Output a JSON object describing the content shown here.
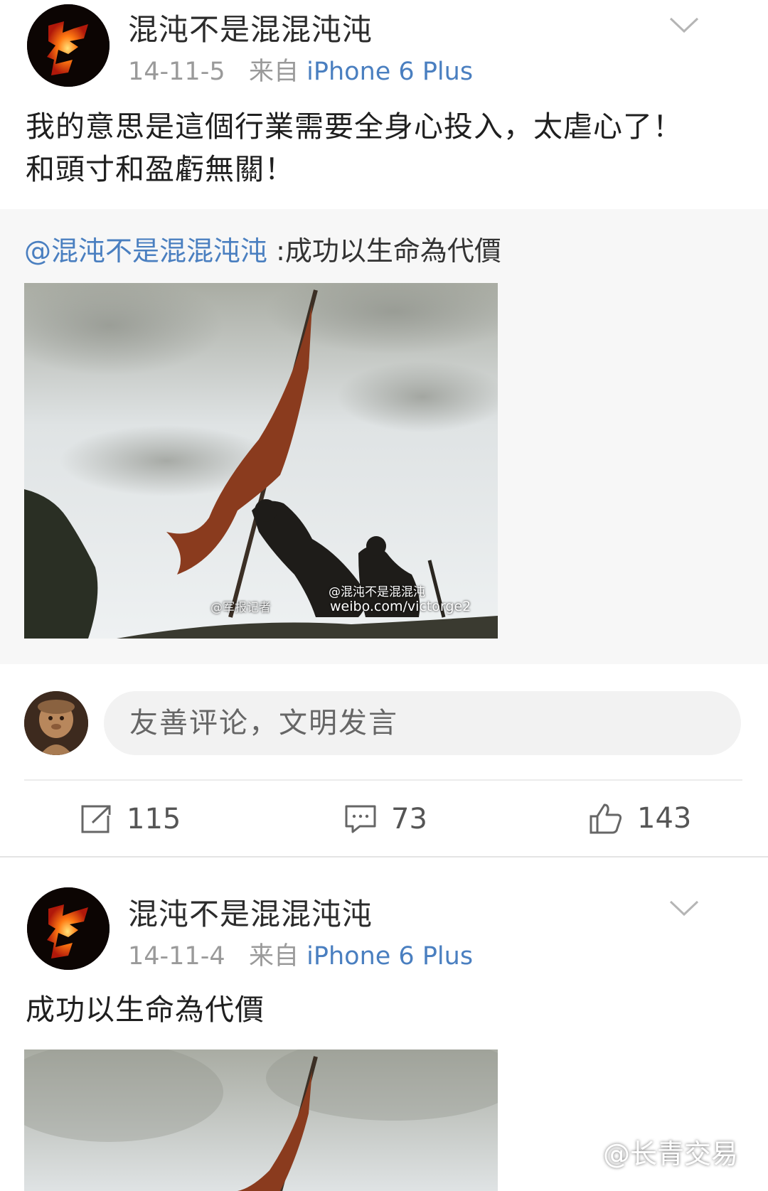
{
  "post1": {
    "username": "混沌不是混混沌沌",
    "date": "14-11-5",
    "from_label": "来自",
    "source": "iPhone 6 Plus",
    "text_line1": "我的意思是這個行業需要全身心投入，太虐心了！",
    "text_line2": "和頭寸和盈虧無關！",
    "retweet": {
      "user": "@混沌不是混混沌沌",
      "text": ":成功以生命為代價",
      "photo_watermark_user": "@混沌不是混混沌",
      "photo_watermark_url": "weibo.com/victorge2",
      "photo_credit": "@军报记者"
    }
  },
  "comment_bar": {
    "placeholder": "友善评论，文明发言"
  },
  "actions": {
    "repost_count": "115",
    "comment_count": "73",
    "like_count": "143"
  },
  "post2": {
    "username": "混沌不是混混沌沌",
    "date": "14-11-4",
    "from_label": "来自",
    "source": "iPhone 6 Plus",
    "text": "成功以生命為代價"
  },
  "watermark": "@长青交易",
  "icons": {
    "more": "chevron-down-icon",
    "repost": "repost-icon",
    "comment": "comment-icon",
    "like": "thumbs-up-icon"
  }
}
